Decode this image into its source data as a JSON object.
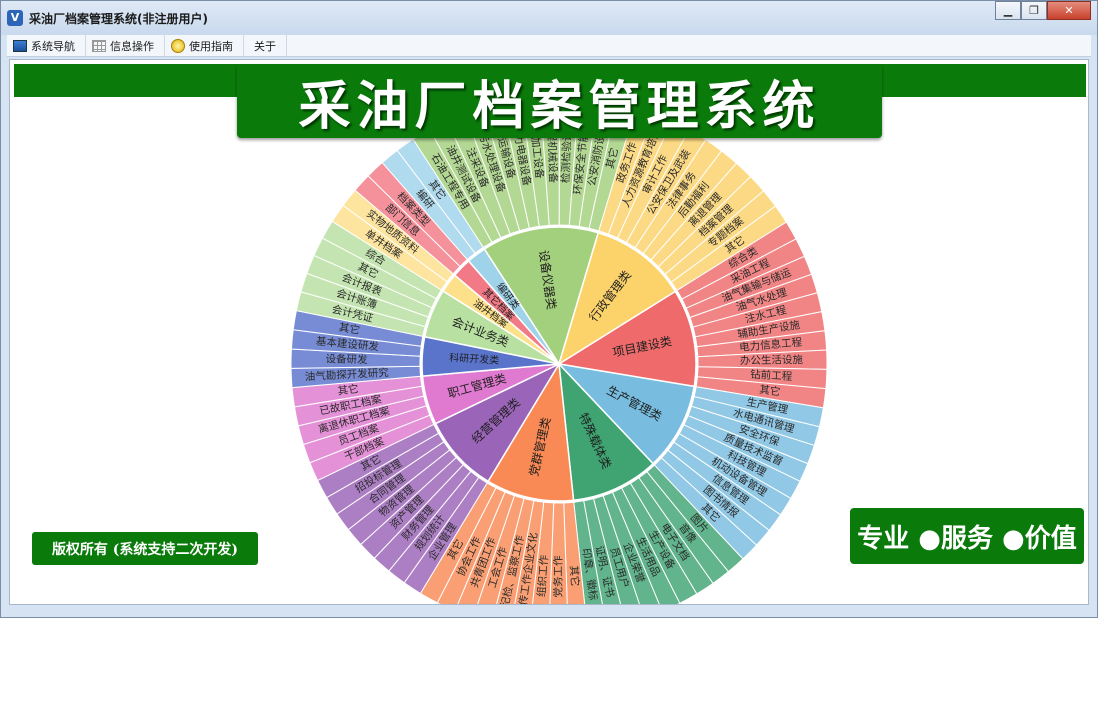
{
  "window": {
    "title": "采油厂档案管理系统(非注册用户)",
    "app_icon_glyph": "V",
    "controls": {
      "minimize": "▁",
      "maximize": "❐",
      "close": "✕"
    }
  },
  "menu": [
    {
      "label": "系统导航",
      "icon": "navigation-icon"
    },
    {
      "label": "信息操作",
      "icon": "grid-icon"
    },
    {
      "label": "使用指南",
      "icon": "guide-icon"
    },
    {
      "label": "关于",
      "icon": ""
    }
  ],
  "banner": {
    "title": "采油厂档案管理系统"
  },
  "copyright": "版权所有 (系统支持二次开发)",
  "slogan": "专业 ●服务 ●价值",
  "wheel": {
    "categories": [
      {
        "name": "设备仪器类",
        "color": "#a3d07c",
        "items": [
          "石油工程专用",
          "油井测试设备",
          "注采设备",
          "污水处理设备",
          "运输设备",
          "动力电器设备",
          "机加工设备",
          "工程机械设备",
          "检测检验设备",
          "环保安全节能设备",
          "公安消防设备",
          "其它"
        ]
      },
      {
        "name": "行政管理类",
        "color": "#fcd36b",
        "items": [
          "政务工作",
          "人力资源教育培训",
          "审计工作",
          "公安保卫及武装",
          "法律事务",
          "后勤福利",
          "离退管理",
          "档案管理",
          "专题档案",
          "其它"
        ]
      },
      {
        "name": "项目建设类",
        "color": "#ef6b6b",
        "items": [
          "综合类",
          "采油工程",
          "油气集输与储运",
          "油气水处理",
          "注水工程",
          "辅助生产设施",
          "电力信息工程",
          "办公生活设施",
          "钻前工程",
          "其它"
        ]
      },
      {
        "name": "生产管理类",
        "color": "#78bde0",
        "items": [
          "生产管理",
          "水电通讯管理",
          "安全环保",
          "质量技术监督",
          "科技管理",
          "机动设备管理",
          "信息管理",
          "图书情报",
          "其它"
        ]
      },
      {
        "name": "特殊载体类",
        "color": "#3fa472",
        "items": [
          "图片",
          "音像",
          "电子文档",
          "生产设备",
          "生活用品",
          "企业荣誉",
          "员工用户",
          "证明、证书",
          "印章、徽标"
        ]
      },
      {
        "name": "党群管理类",
        "color": "#fa8a55",
        "items": [
          "其它",
          "党务工作",
          "组织工作",
          "宣传工作企业文化",
          "纪检、监察工作",
          "工会工作",
          "共青团工作",
          "协会工作",
          "其它"
        ]
      },
      {
        "name": "经营管理类",
        "color": "#9a64b8",
        "items": [
          "企业管理",
          "规划统计",
          "财务管理",
          "资产管理",
          "物资管理",
          "合同管理",
          "招投标管理",
          "其它"
        ]
      },
      {
        "name": "职工管理类",
        "color": "#e07ad0",
        "items": [
          "干部档案",
          "员工档案",
          "离退休职工档案",
          "已故职工档案",
          "其它"
        ]
      },
      {
        "name": "科研开发类",
        "color": "#5a74cc",
        "items": [
          "油气勘探开发研究",
          "设备研发",
          "基本建设研发",
          "其它"
        ]
      },
      {
        "name": "会计业务类",
        "color": "#b8e0a0",
        "items": [
          "会计凭证",
          "会计账簿",
          "会计报表",
          "其它",
          "综合"
        ]
      },
      {
        "name": "油井档案",
        "color": "#fde08a",
        "items": [
          "单井档案",
          "实物地质资料"
        ]
      },
      {
        "name": "其它档案",
        "color": "#f27a86",
        "items": [
          "部门信息",
          "档案类型"
        ]
      },
      {
        "name": "编研类",
        "color": "#9fd3ea",
        "items": [
          "编研",
          "其它"
        ]
      }
    ]
  }
}
